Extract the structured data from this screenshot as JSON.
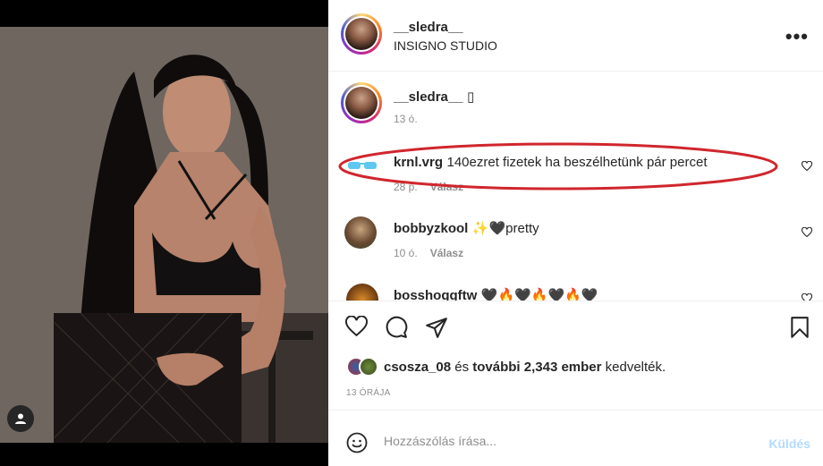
{
  "post": {
    "author": "__sledra__",
    "location": "INSIGNO STUDIO",
    "more_icon": "more-horizontal-icon"
  },
  "caption": {
    "username": "__sledra__",
    "text": "▯",
    "time": "13 ó."
  },
  "comments": [
    {
      "username": "krnl.vrg",
      "text": "140ezret fizetek ha beszélhetünk pár percet",
      "time": "28 p.",
      "reply": "Válasz",
      "avatar_icon": "sunglasses-emoji"
    },
    {
      "username": "bobbyzkool",
      "text": "✨🖤pretty",
      "time": "10 ó.",
      "reply": "Válasz"
    },
    {
      "username": "bosshoggftw",
      "text": "🖤🔥🖤🔥🖤🔥🖤"
    }
  ],
  "likes": {
    "first_user": "csosza_08",
    "joiner": "és",
    "others": "további 2,343 ember",
    "suffix": "kedvelték."
  },
  "timestamp": "13 ÓRÁJA",
  "add_comment": {
    "placeholder": "Hozzászólás írása...",
    "post_label": "Küldés"
  },
  "colors": {
    "annotation": "#d0262d",
    "link_blue_disabled": "#b3dbff",
    "secondary_text": "#8e8e8e"
  }
}
